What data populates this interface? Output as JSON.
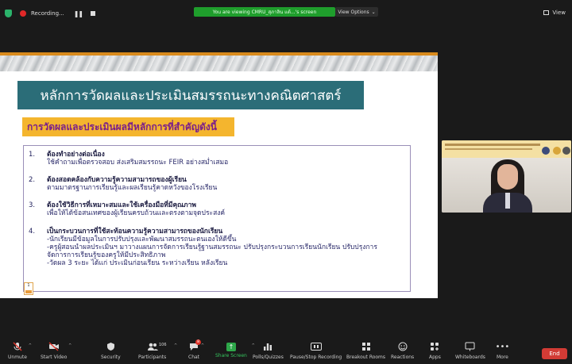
{
  "topbar": {
    "recording_label": "Recording...",
    "pause_glyph": "❚❚",
    "banner": "You are viewing CMRU_สุภาลิน แต้...'s screen",
    "view_options": "View Options",
    "view_options_caret": "⌄",
    "view_label": "View"
  },
  "slide": {
    "title": "หลักการวัดผลและประเมินสมรรถนะทางคณิตศาสตร์",
    "subtitle": "การวัดผลและประเมินผลมีหลักการที่สำคัญดังนี้",
    "items": [
      {
        "num": "1.",
        "head": "ต้องทำอย่างต่อเนื่อง",
        "lines": [
          "ใช้คำถามเพื่อตรวจสอบ ส่งเสริมสมรรถนะ FEIR อย่างสม่ำเสมอ"
        ]
      },
      {
        "num": "2.",
        "head": "ต้องสอดคล้องกับความรู้ความสามารถของผู้เรียน",
        "lines": [
          "ตามมาตรฐานการเรียนรู้และผลเรียนรู้คาดหวังของโรงเรียน"
        ]
      },
      {
        "num": "3.",
        "head": "ต้องใช้วิธีการที่เหมาะสมและใช้เครื่องมือที่มีคุณภาพ",
        "lines": [
          "เพื่อให้ได้ข้อสนเทศของผู้เรียนครบถ้วนและตรงตามจุดประสงค์"
        ]
      },
      {
        "num": "4.",
        "head": "เป็นกระบวนการที่ใช้สะท้อนความรู้ความสามารถของนักเรียน",
        "lines": [
          "-นักเรียนมีข้อมูลในการปรับปรุงและพัฒนาสมรรถนะตนเองให้ดีขึ้น",
          "-ครูผู้สอนนำผลประเมินฯ มาวางแผนการจัดการเรียนรู้ฐานสมรรถนะ ปรับปรุงกระบวนการเรียนนักเรียน ปรับปรุงการ",
          "จัดการการเรียนรู้ของครูให้มีประสิทธิภาพ",
          "-วัดผล 3 ระยะ ได้แก่ ประเมินก่อนเรียน ระหว่างเรียน หลังเรียน"
        ]
      }
    ],
    "page_number": "1"
  },
  "toolbar": {
    "items": [
      {
        "label": "Unmute",
        "icon": "mic-muted-icon"
      },
      {
        "label": "Start Video",
        "icon": "video-off-icon"
      },
      {
        "label": "Security",
        "icon": "shield-icon"
      },
      {
        "label": "Participants",
        "icon": "people-icon",
        "count": "106"
      },
      {
        "label": "Chat",
        "icon": "chat-icon",
        "badge": "8"
      },
      {
        "label": "Share Screen",
        "icon": "share-screen-icon"
      },
      {
        "label": "Polls/Quizzes",
        "icon": "poll-icon"
      },
      {
        "label": "Pause/Stop Recording",
        "icon": "pause-recording-icon"
      },
      {
        "label": "Breakout Rooms",
        "icon": "breakout-rooms-icon"
      },
      {
        "label": "Reactions",
        "icon": "reactions-icon"
      },
      {
        "label": "Apps",
        "icon": "apps-icon"
      },
      {
        "label": "Whiteboards",
        "icon": "whiteboard-icon"
      },
      {
        "label": "More",
        "icon": "more-icon"
      }
    ],
    "end_label": "End"
  },
  "colors": {
    "title_bar": "#2b6d78",
    "subtitle_bg": "#f4b52e",
    "subtitle_text": "#7a1f8a",
    "share_green": "#2ea84a",
    "end_red": "#d23b35",
    "recording_red": "#e02828"
  }
}
